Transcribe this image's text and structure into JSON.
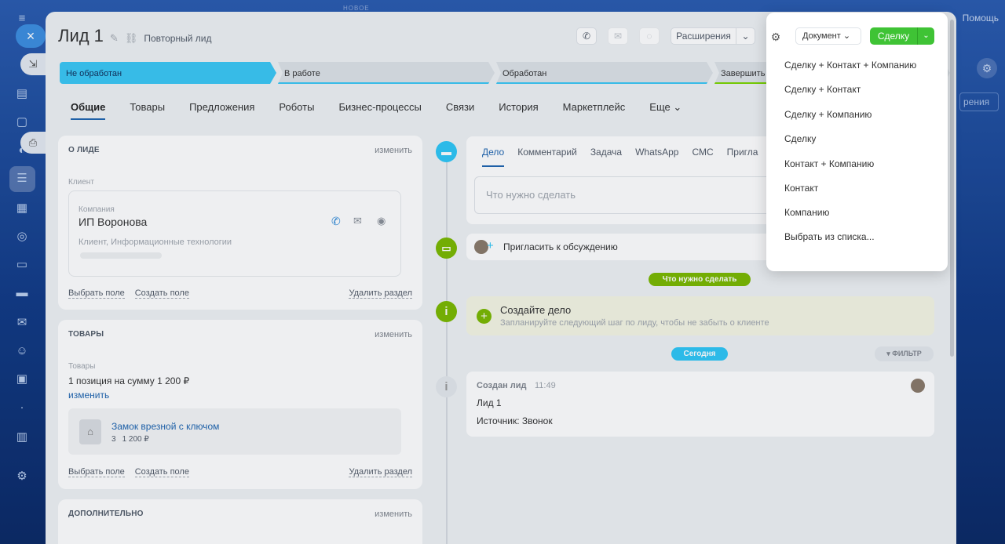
{
  "background": {
    "new_label": "НОВОЕ",
    "help_label": "Помощь",
    "right_button_label": "рения"
  },
  "header": {
    "title": "Лид 1",
    "subtitle": "Повторный лид",
    "extensions_label": "Расширения",
    "document_label": "Документ",
    "deal_label": "Сделку"
  },
  "stages": [
    "Не обработан",
    "В работе",
    "Обработан",
    "Завершить с"
  ],
  "tabs": [
    "Общие",
    "Товары",
    "Предложения",
    "Роботы",
    "Бизнес-процессы",
    "Связи",
    "История",
    "Маркетплейс",
    "Еще"
  ],
  "about": {
    "heading": "О ЛИДЕ",
    "edit": "изменить",
    "client_label": "Клиент",
    "company_label": "Компания",
    "company_name": "ИП Воронова",
    "company_meta": "Клиент, Информационные технологии",
    "select_field": "Выбрать поле",
    "create_field": "Создать поле",
    "delete_section": "Удалить раздел"
  },
  "goods": {
    "heading": "ТОВАРЫ",
    "edit": "изменить",
    "label": "Товары",
    "summary": "1 позиция на сумму 1 200 ₽",
    "change": "изменить",
    "item_name": "Замок врезной с ключом",
    "item_qty": "3",
    "item_price": "1 200 ₽",
    "select_field": "Выбрать поле",
    "create_field": "Создать поле",
    "delete_section": "Удалить раздел"
  },
  "extra": {
    "heading": "ДОПОЛНИТЕЛЬНО",
    "edit": "изменить"
  },
  "timeline": {
    "tabs": [
      "Дело",
      "Комментарий",
      "Задача",
      "WhatsApp",
      "СМС",
      "Пригла"
    ],
    "todo_placeholder": "Что нужно сделать",
    "invite": "Пригласить к обсуждению",
    "todo_pill": "Что нужно сделать",
    "create_title": "Создайте дело",
    "create_sub": "Запланируйте следующий шаг по лиду, чтобы не забыть о клиенте",
    "today_pill": "Сегодня",
    "filter": "ФИЛЬТР",
    "created_title": "Создан лид",
    "created_time": "11:49",
    "created_line1": "Лид 1",
    "created_line2": "Источник: Звонок"
  },
  "dropdown": {
    "items": [
      "Сделку + Контакт + Компанию",
      "Сделку + Контакт",
      "Сделку + Компанию",
      "Сделку",
      "Контакт + Компанию",
      "Контакт",
      "Компанию",
      "Выбрать из списка..."
    ]
  },
  "colors": {
    "stage_active": "#3bc8f5",
    "deal_button": "#3fc335",
    "todo_pill": "#7bb800",
    "today_pill": "#2fc6f6"
  }
}
